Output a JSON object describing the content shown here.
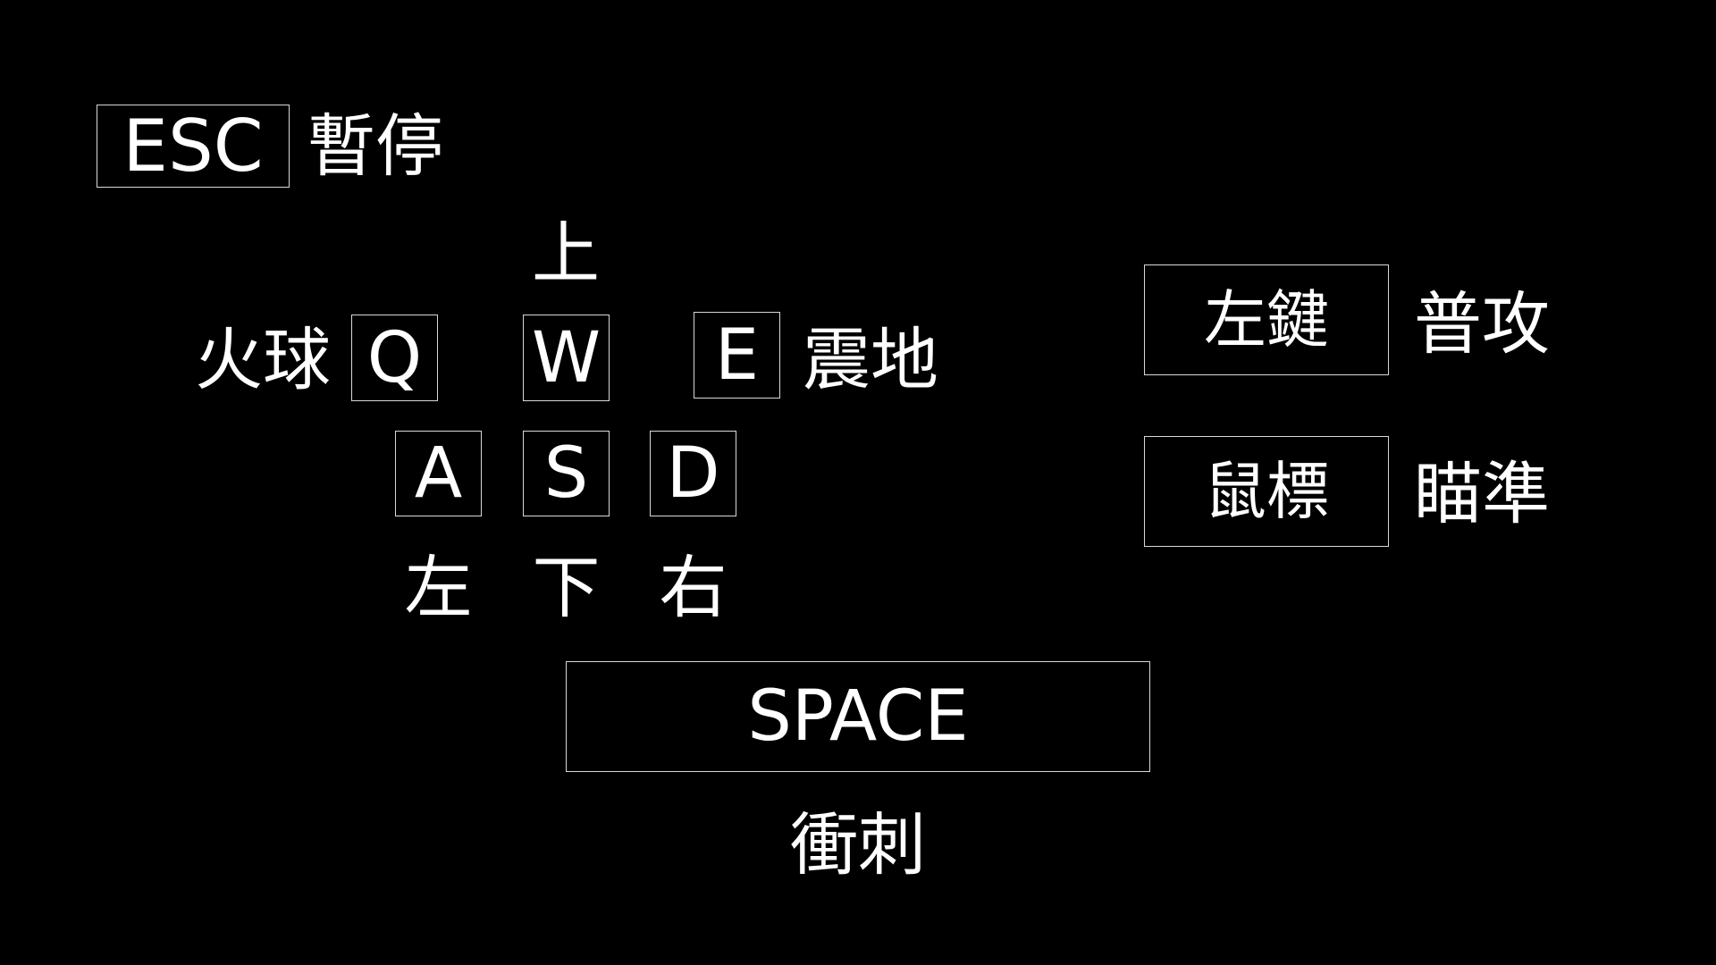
{
  "esc": {
    "key": "ESC",
    "action": "暫停"
  },
  "skills": {
    "q": {
      "key": "Q",
      "action": "火球"
    },
    "e": {
      "key": "E",
      "action": "震地"
    }
  },
  "movement": {
    "w": {
      "key": "W",
      "action": "上"
    },
    "a": {
      "key": "A",
      "action": "左"
    },
    "s": {
      "key": "S",
      "action": "下"
    },
    "d": {
      "key": "D",
      "action": "右"
    }
  },
  "mouse": {
    "left_click": {
      "key": "左鍵",
      "action": "普攻"
    },
    "mouse_move": {
      "key": "鼠標",
      "action": "瞄準"
    }
  },
  "space": {
    "key": "SPACE",
    "action": "衝刺"
  },
  "colors": {
    "background": "#000000",
    "foreground": "#ffffff",
    "key_border": "#d8d8d8"
  }
}
